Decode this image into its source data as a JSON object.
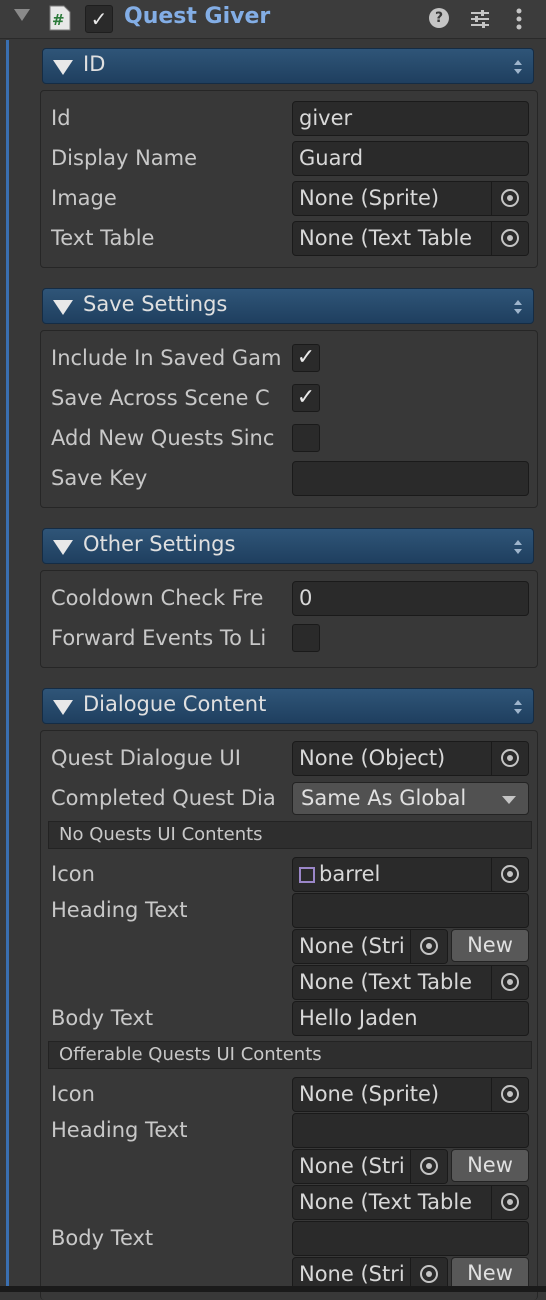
{
  "component": {
    "title": "Quest Giver",
    "enabled": true
  },
  "sections": {
    "id": {
      "title": "ID"
    },
    "save": {
      "title": "Save Settings"
    },
    "other": {
      "title": "Other Settings"
    },
    "dialogue": {
      "title": "Dialogue Content"
    }
  },
  "id_section": {
    "id_label": "Id",
    "id_value": "giver",
    "display_name_label": "Display Name",
    "display_name_value": "Guard",
    "image_label": "Image",
    "image_value": "None (Sprite)",
    "text_table_label": "Text Table",
    "text_table_value": "None (Text Table"
  },
  "save_section": {
    "include_label": "Include In Saved Gam",
    "include_checked": true,
    "save_across_label": "Save Across Scene C",
    "save_across_checked": true,
    "add_new_label": "Add New Quests Sinc",
    "add_new_checked": false,
    "save_key_label": "Save Key",
    "save_key_value": ""
  },
  "other_section": {
    "cooldown_label": "Cooldown Check Fre",
    "cooldown_value": "0",
    "forward_label": "Forward Events To Li",
    "forward_checked": false
  },
  "dialogue_section": {
    "quest_dialogue_ui_label": "Quest Dialogue UI",
    "quest_dialogue_ui_value": "None (Object)",
    "completed_label": "Completed Quest Dia",
    "completed_value": "Same As Global",
    "no_quests": {
      "header": "No Quests UI Contents",
      "icon_label": "Icon",
      "icon_value": "barrel",
      "heading_label": "Heading Text",
      "heading_value": "",
      "heading_string": "None (Stri",
      "new_label": "New",
      "heading_table": "None (Text Table",
      "body_label": "Body Text",
      "body_value": "Hello Jaden"
    },
    "offerable": {
      "header": "Offerable Quests UI Contents",
      "icon_label": "Icon",
      "icon_value": "None (Sprite)",
      "heading_label": "Heading Text",
      "heading_value": "",
      "heading_string": "None (Stri",
      "new_label": "New",
      "heading_table": "None (Text Table",
      "body_label": "Body Text",
      "body_value": "",
      "body_string": "None (Stri",
      "body_new_label": "New"
    }
  },
  "icons": [
    "foldout-arrow",
    "script-icon",
    "help-icon",
    "preset-icon",
    "menu-icon",
    "object-picker-icon",
    "sprite-icon"
  ]
}
